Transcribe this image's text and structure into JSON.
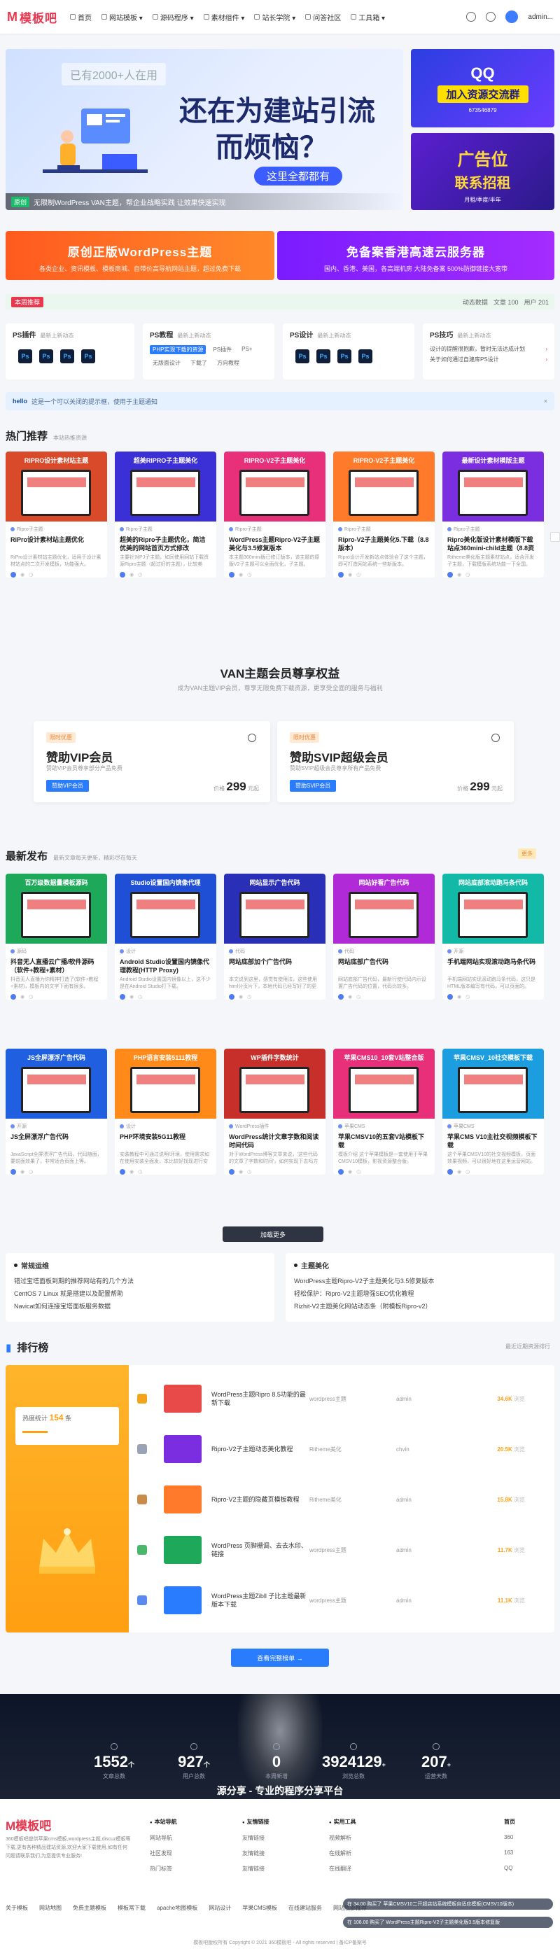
{
  "header": {
    "logo": "模板吧",
    "nav": [
      {
        "label": "首页"
      },
      {
        "label": "网站模板 ▾"
      },
      {
        "label": "源码程序 ▾"
      },
      {
        "label": "素材组件 ▾"
      },
      {
        "label": "站长学院 ▾"
      },
      {
        "label": "问答社区"
      },
      {
        "label": "工具箱 ▾"
      }
    ],
    "user": "admin..."
  },
  "hero": {
    "badge": "已有2000+人在用",
    "title1": "还在为建站引流",
    "title2": "而烦恼？",
    "sub": "这里全都都有",
    "tag": "原创",
    "caption": "无限制WordPress VAN主题，帮企业战略实践 让效果快速实现"
  },
  "side_banners": [
    {
      "title": "QQ",
      "sub": "加入资源交流群",
      "num": "673546879"
    },
    {
      "title": "广告位",
      "sub": "联系招租",
      "num": "月租/季度/半年"
    }
  ],
  "promos": [
    {
      "title": "原创正版WordPress主题",
      "sub": "各类企业、资讯模板、模板商城、自带价高导航网站主题，超过免费下载"
    },
    {
      "title": "免备案香港高速云服务器",
      "sub": "国内、香港、美国，各高端机房 大陆免备案 500%防御链接大宽带"
    }
  ],
  "ticker": {
    "text": "本周推荐",
    "right": [
      "动态数据",
      "文章 100",
      "用户 201"
    ]
  },
  "categories": [
    {
      "title": "PS插件",
      "sub": "最新上新动态",
      "icons": [
        "Ps",
        "Ps",
        "Ps",
        "Ps"
      ]
    },
    {
      "title": "PS教程",
      "sub": "最新上新动态",
      "tags": [
        "PHP实现下载的资源",
        "PS插件",
        "PS+",
        "无版面设计",
        "下载了",
        "方向教程"
      ]
    },
    {
      "title": "PS设计",
      "sub": "最新上新动态",
      "icons": [
        "Ps",
        "Ps",
        "Ps",
        "Ps"
      ]
    },
    {
      "title": "PS技巧",
      "sub": "最新上新动态",
      "items": [
        "设计的提醒很抱歉，暂时无法达成计划",
        "关于如何通过自建库PS设计"
      ]
    }
  ],
  "notice": {
    "label": "hello",
    "text": "这是一个可以关闭的提示框，使用于主题通知",
    "close": "×"
  },
  "hot": {
    "title": "热门推荐",
    "sub": "本站热推资源",
    "items": [
      {
        "banner": "RIPRO设计素材站主题",
        "cat": "Ripro子主题",
        "title": "RiPro设计素材站主题优化",
        "desc": "RiPro设计素材站主题优化，适用于设计素材站点的二次开发模板，功能强大。",
        "color": "#d84a2a"
      },
      {
        "banner": "超美RIPRO子主题美化",
        "cat": "Ripro子主题",
        "title": "超美的Ripro子主题优化，简洁优美的网站首页方式修改",
        "desc": "主要针对PJ子主题，如同使用网站下载资源Ripro主题（超过好的主题），比较美",
        "color": "#3b2fd6"
      },
      {
        "banner": "RIPRO-V2子主题美化",
        "cat": "Ripro子主题",
        "title": "WordPress主题Ripro-V2子主题美化与3.5修复版本",
        "desc": "本主题360mini版已修订版本，该主题的原版V2子主题可以全面优化，子主题。",
        "color": "#e8307a"
      },
      {
        "banner": "RIPRO-V2子主题美化",
        "cat": "Ripro子主题",
        "title": "Ripro-V2子主题美化5.下载（8.8版本）",
        "desc": "Ripro设计开发新站点体验合了这个主题，即可打造网站系统一些新版本。",
        "color": "#ff7a2a"
      },
      {
        "banner": "最新设计素材模版主题",
        "cat": "Ripro子主题",
        "title": "Ripro美化版设计素材模版下载站点360mini-child主题（8.8资源版）",
        "desc": "Ritheme美化版主题素材站点，适合开发子主题，下载模版系统功能一下全国。",
        "color": "#7b2ee0"
      }
    ]
  },
  "vip": {
    "title": "VAN主题会员尊享权益",
    "sub": "成为VAN主题VIP会员，尊享无限免费下载资源，更享受全面的服务与福利",
    "plans": [
      {
        "tag": "限时优惠",
        "name": "赞助VIP会员",
        "desc": "赞助VIP会员尊享部分产品免费",
        "btn": "赞助VIP会员",
        "price_label": "价格",
        "price": "299",
        "unit": "元起"
      },
      {
        "tag": "限时优惠",
        "name": "赞助SVIP超级会员",
        "desc": "赞助SVIP超级会员尊享所有产品免费",
        "btn": "赞助SVIP会员",
        "price_label": "价格",
        "price": "299",
        "unit": "元起"
      }
    ]
  },
  "latest": {
    "title": "最新发布",
    "sub": "最新文章每天更新，精彩尽在每天",
    "badge": "更多",
    "items": [
      {
        "banner": "百万级数据量模板源码",
        "cat": "源码",
        "title": "抖音无人直播云广播/软件源码（软件+教程+素材）",
        "desc": "抖音无人直播为你精神打造了(软件+教程+素材)，模板内的文字下面有很多。",
        "color": "#1da85a"
      },
      {
        "banner": "Studio设置国内镜像代理",
        "cat": "设计",
        "title": "Android Studio设置国内镜像代理教程(HTTP Proxy)",
        "desc": "Android Studio设置国内镜像以上，这不少是在Android Studio打下载。",
        "color": "#1f4fd4"
      },
      {
        "banner": "网站显示广告代码",
        "cat": "代码",
        "title": "网站底部加个广告代码",
        "desc": "本文说到这里，感觉有使用法，这些使用html分页片下，本地代码已经写好了的更多。",
        "color": "#2a2fb8"
      },
      {
        "banner": "网站好看广告代码",
        "cat": "代码",
        "title": "网站底部广告代码",
        "desc": "网站底部广告代码，最新行使代码内示设置广告代码的位置，代码比较多。",
        "color": "#b02ad8"
      },
      {
        "banner": "网站底部滚动跑马条代码",
        "cat": "开源",
        "title": "手机端网站实现滚动跑马条代码",
        "desc": "手机端网站实现滚动跑马条代码，这只是HTML版本编写有代码，可以页面的。",
        "color": "#11b9a6"
      },
      {
        "banner": "JS全屏漂浮广告代码",
        "cat": "开源",
        "title": "JS全屏漂浮广告代码",
        "desc": "JavaScript全屏漂浮广告代码，代码随面，要前面效果了，非常适合页面上等。",
        "color": "#1f5fe0"
      },
      {
        "banner": "PHP语言安装5111教程",
        "cat": "设计",
        "title": "PHP环境安装5G11教程",
        "desc": "安装教程中可通过说明/环境，使用需求如在使用安装全面发，本比较好找现进行安装系统。",
        "color": "#ff8a1a"
      },
      {
        "banner": "WP插件字数统计",
        "cat": "WordPress插件",
        "title": "WordPress统计文章字数和阅读时间代码",
        "desc": "对于WordPress博客文章来说，'这些代码的文章了字数和时间'，如何实现下去吗方",
        "color": "#c7302a"
      },
      {
        "banner": "苹果CMS10_10套V站整合版",
        "cat": "苹果CMS",
        "title": "苹果CMSV10的五套V站模板下载",
        "desc": "模板介绍 这个苹果模板是一套使用于苹果CMSV10模板，影视资源整合版。",
        "color": "#e8307a"
      },
      {
        "banner": "苹果CMSV_10社交模板下载",
        "cat": "苹果CMS",
        "title": "苹果CMS V10主社交视频模板下载",
        "desc": "这个苹果CMSV10的社交视频模板，页面效果视频，可以很好地在这里运营网站。",
        "color": "#1b9de0"
      }
    ],
    "more_btn": "加载更多"
  },
  "links": [
    {
      "title": "常规运维",
      "items": [
        "错过宝塔面板到期的推荐网站有的几个方法",
        "CentOS 7 Linux 就是搭建以及配置帮助",
        "Navicat如何连接宝塔面板服务数据"
      ]
    },
    {
      "title": "主题美化",
      "items": [
        "WordPress主题Ripro-V2子主题美化与3.5修复版本",
        "轻松保护：Ripro-V2主题增强SEO优化教程",
        "Rizhit-V2主题美化网站动态条（附模板Ripro-v2）"
      ]
    }
  ],
  "rank": {
    "title": "排行榜",
    "sub": "最近近期资源排行",
    "stat_label": "热度统计",
    "stat_value": "154",
    "stat_unit": "条",
    "rows": [
      {
        "name": "WordPress主题Ripro 8.5功能的最新下载",
        "cat": "wordpress主题",
        "author": "admin",
        "hot": "34.6K",
        "unit": "浏览",
        "medal": "#f2a51a",
        "thumb": "#e84a4a"
      },
      {
        "name": "Ripro-V2子主题动态美化教程",
        "cat": "Ritheme美化",
        "author": "chvin",
        "hot": "20.5K",
        "unit": "浏览",
        "medal": "#9aa3b5",
        "thumb": "#7b2ee0"
      },
      {
        "name": "Ripro-V2主题的隐藏页模板教程",
        "cat": "Ritheme美化",
        "author": "admin",
        "hot": "15.8K",
        "unit": "浏览",
        "medal": "#c98a4a",
        "thumb": "#ff7a2a"
      },
      {
        "name": "WordPress 页脚栅调、去去水印、链接",
        "cat": "wordpress主题",
        "author": "admin",
        "hot": "11.7K",
        "unit": "浏览",
        "medal": "#4ab86a",
        "thumb": "#1da85a"
      },
      {
        "name": "WordPress主题Zibll 子比主题最新版本下载",
        "cat": "wordpress主题",
        "author": "admin",
        "hot": "11.1K",
        "unit": "浏览",
        "medal": "#5a8af0",
        "thumb": "#2a7cff"
      }
    ],
    "btn": "查看完整榜单 →"
  },
  "stats": {
    "items": [
      {
        "num": "1552",
        "unit": "个",
        "label": "文章总数"
      },
      {
        "num": "927",
        "unit": "个",
        "label": "用户总数"
      },
      {
        "num": "0",
        "unit": "",
        "label": "本周新增"
      },
      {
        "num": "3924129",
        "unit": "+",
        "label": "浏览总数"
      },
      {
        "num": "207",
        "unit": "+",
        "label": "运营天数"
      }
    ],
    "slogan": "源分享 - 专业的程序分享平台"
  },
  "footer": {
    "logo": "模板吧",
    "desc": "360模板吧提供苹果cms模板,wordpress主题,discuz模板等下载,更有各种精品建站资源,欢迎大家下载使用,如有任何问题请联系我们,为您提供专业服务!",
    "cols": [
      {
        "title": "本站导航",
        "items": [
          "网站导航",
          "社区发现",
          "热门标签"
        ]
      },
      {
        "title": "友情链接",
        "items": [
          "友情链接",
          "友情链接",
          "友情链接"
        ]
      },
      {
        "title": "实用工具",
        "items": [
          "视频解析",
          "在线解析",
          "在线翻译"
        ]
      }
    ],
    "qr": {
      "title": "首页",
      "items": [
        "360",
        "163",
        "QQ"
      ]
    },
    "links": [
      "关于模板",
      "网站地图",
      "免费主题模板",
      "模板常下载",
      "apache地图模板",
      "网站设计",
      "苹果CMS模板",
      "在线建站服务",
      "网站底部推荐"
    ],
    "copyright": "模板吧版权所有 Copyright © 2021 360模板吧 - All rights reserved | 备ICP备案号",
    "toasts": [
      "在 34.00 购买了 苹果CMSV10二开超店站系统模板自适应模板(CMSV10版本)",
      "在 108.00 购买了 WordPress主题Ripro-V2子主题美化版3.5版本修复版"
    ]
  }
}
